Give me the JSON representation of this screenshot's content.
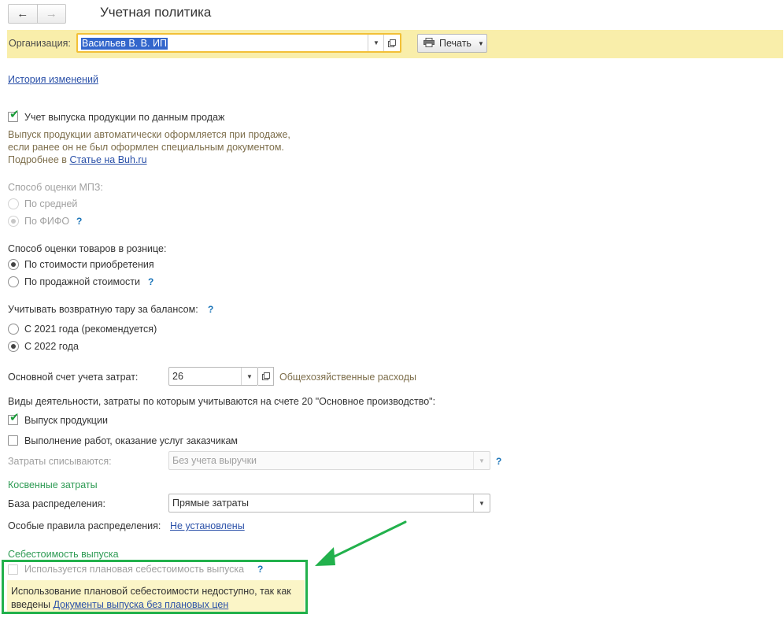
{
  "nav": {
    "back_icon": "arrow-left-icon",
    "forward_icon": "arrow-right-icon"
  },
  "title": "Учетная политика",
  "org": {
    "label": "Организация:",
    "value": "Васильев В. В. ИП"
  },
  "print": {
    "label": "Печать",
    "icon": "printer-icon"
  },
  "history_link": "История изменений",
  "sales_output": {
    "label": "Учет выпуска продукции по данным продаж",
    "checked": true,
    "desc_line1": "Выпуск продукции автоматически оформляется при продаже,",
    "desc_line2": "если ранее он не был оформлен специальным документом.",
    "more_prefix": "Подробнее в",
    "more_link": "Статье на Buh.ru"
  },
  "mpz": {
    "label": "Способ оценки МПЗ:",
    "option_avg": "По средней",
    "option_fifo": "По ФИФО",
    "selected": "fifo"
  },
  "retail": {
    "label": "Способ оценки товаров в рознице:",
    "option_purchase": "По стоимости приобретения",
    "option_sale": "По продажной стоимости",
    "selected": "purchase"
  },
  "tara": {
    "label": "Учитывать возвратную тару за балансом:",
    "option_2021": "С 2021 года (рекомендуется)",
    "option_2022": "С 2022 года",
    "selected": "2022"
  },
  "cost_account": {
    "label": "Основной счет учета затрат:",
    "value": "26",
    "description": "Общехозяйственные расходы"
  },
  "activities": {
    "label": "Виды деятельности, затраты по которым учитываются на счете 20 \"Основное производство\":",
    "production": "Выпуск продукции",
    "production_checked": true,
    "services": "Выполнение работ, оказание услуг заказчикам",
    "services_checked": false
  },
  "writeoff": {
    "label": "Затраты списываются:",
    "value": "Без учета выручки"
  },
  "indirect": {
    "heading": "Косвенные затраты",
    "base_label": "База распределения:",
    "base_value": "Прямые затраты",
    "rules_label": "Особые правила распределения:",
    "rules_link": "Не установлены"
  },
  "cost": {
    "heading": "Себестоимость выпуска",
    "planned_label": "Используется плановая себестоимость выпуска",
    "planned_checked": false,
    "warning_line1": "Использование плановой себестоимости недоступно, так как",
    "warning_prefix": "введены",
    "warning_link": "Документы выпуска без плановых цен"
  },
  "help_mark": "?",
  "colors": {
    "highlight_frame": "#22b14c",
    "arrow": "#22b14c",
    "toolbar": "#f9eeaa",
    "link": "#2a50a8",
    "section_heading": "#2e9b54"
  }
}
